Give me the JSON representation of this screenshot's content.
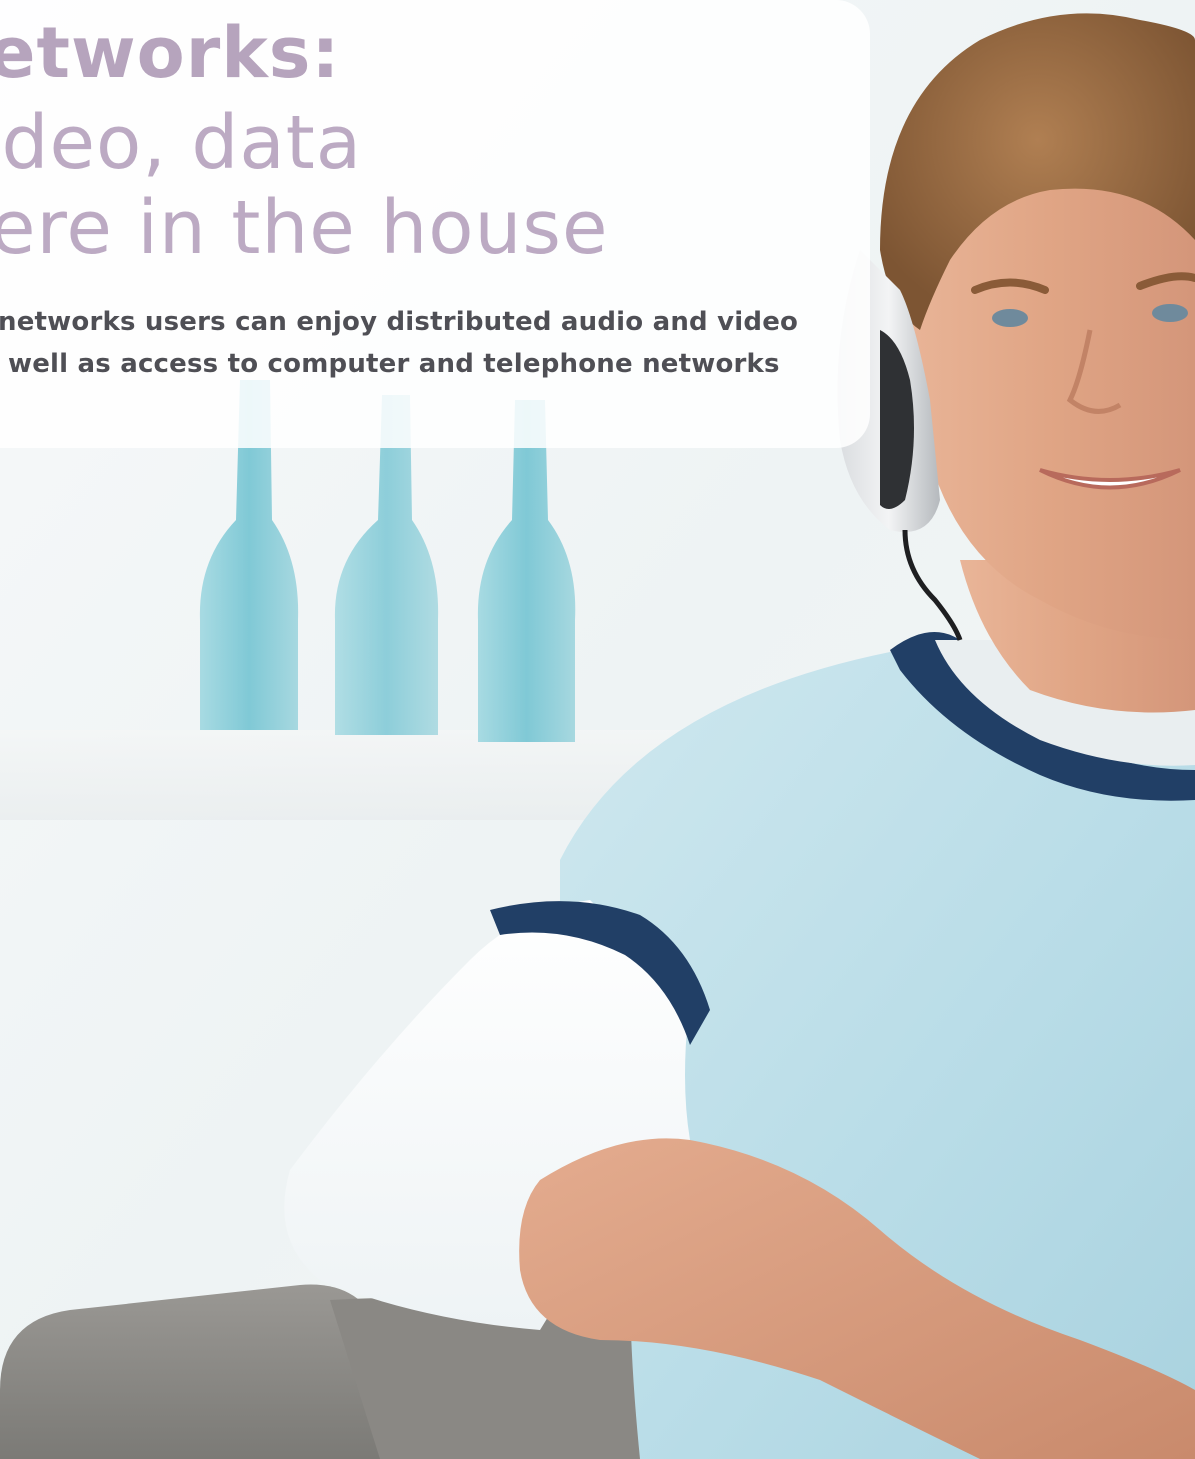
{
  "headline": {
    "line1": "etworks:",
    "line2": "ideo, data",
    "line3": "ere in the house"
  },
  "body": {
    "line1": "networks users can enjoy distributed audio and video",
    "line2": "well as access to computer and telephone networks"
  },
  "photo": {
    "subject": "person-with-headphones",
    "background_objects": [
      "blue-bottle",
      "blue-bottle",
      "blue-bottle",
      "sofa-arm"
    ]
  },
  "colors": {
    "headline": "#b9a7bf",
    "body_text": "#4f4f55",
    "panel": "#ffffff",
    "shirt": "#b9dde8",
    "shirt_trim": "#213f66",
    "skin": "#e2a889",
    "hair": "#9a6b42",
    "bottle": "#71c3d2",
    "sofa": "#8e8c88"
  }
}
